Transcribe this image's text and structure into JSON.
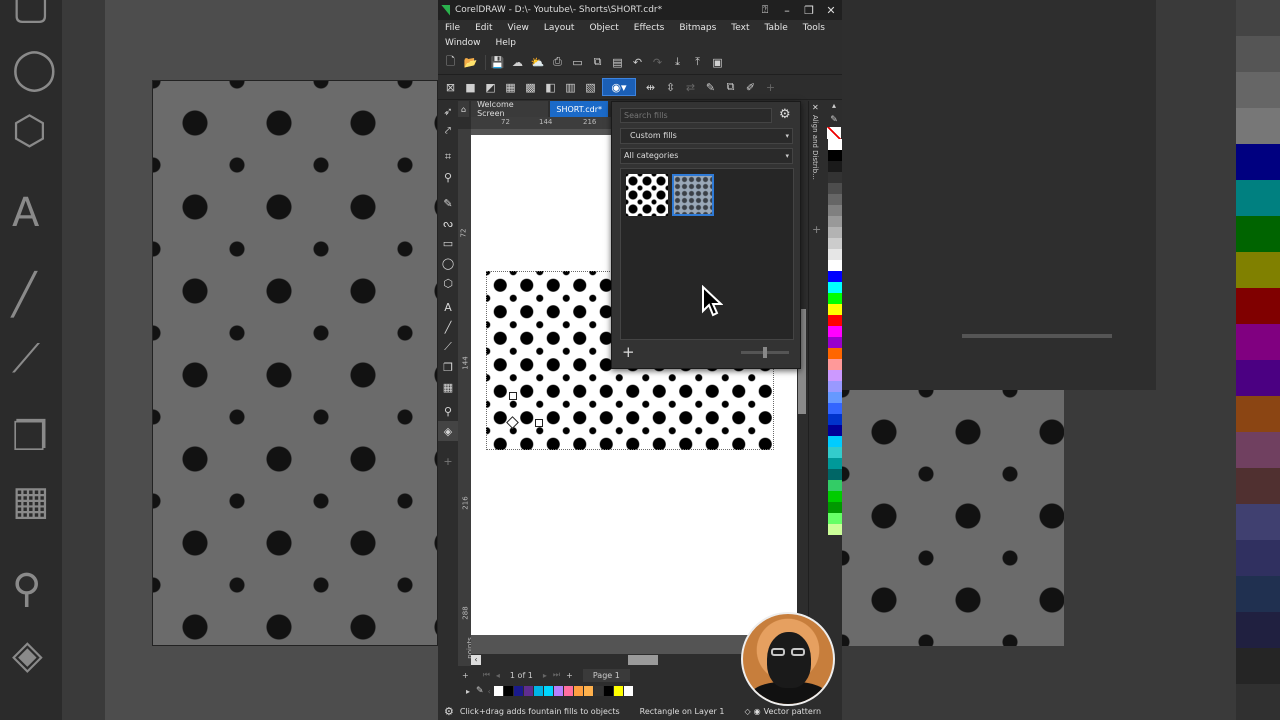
{
  "window": {
    "title": "CorelDRAW - D:\\- Youtube\\- Shorts\\SHORT.cdr*",
    "minimize": "–",
    "restore": "❐",
    "close": "✕"
  },
  "menu": {
    "row1": [
      "File",
      "Edit",
      "View",
      "Layout",
      "Object",
      "Effects",
      "Bitmaps",
      "Text",
      "Table",
      "Tools"
    ],
    "row2": [
      "Window",
      "Help"
    ]
  },
  "tabs": {
    "home_icon": "home-icon",
    "welcome": "Welcome Screen",
    "document": "SHORT.cdr*"
  },
  "rulers": {
    "h_ticks": [
      "72",
      "144",
      "216"
    ],
    "v_ticks": [
      "72",
      "144",
      "216",
      "288"
    ],
    "v_unit": "points"
  },
  "fill_picker": {
    "search_placeholder": "Search fills",
    "source": "Custom fills",
    "category": "All categories"
  },
  "pagebar": {
    "page_count": "1 of 1",
    "page_tab": "Page 1"
  },
  "status": {
    "hint": "Click+drag adds fountain fills to objects",
    "selection": "Rectangle on Layer 1",
    "fill_type": "Vector pattern"
  },
  "colors": {
    "accent": "#1b6ac8",
    "palette_strip": [
      "#ffffff",
      "#000000",
      "#1a1a8c",
      "#5f2d8f",
      "#00b4e6",
      "#00d6ff",
      "#b580ff",
      "#ff6fa0",
      "#ff9f40",
      "#ffb14d",
      "#333333",
      "#000000",
      "#ffff00",
      "#ffffff"
    ],
    "vertical_palette": [
      "#ffffff",
      "#000000",
      "#1a1a1a",
      "#333333",
      "#4d4d4d",
      "#666666",
      "#808080",
      "#999999",
      "#b3b3b3",
      "#cccccc",
      "#e6e6e6",
      "#ffffff",
      "#0000ff",
      "#00ffff",
      "#00ff00",
      "#ffff00",
      "#ff0000",
      "#ff00ff",
      "#9900cc",
      "#ff6600",
      "#ff9999",
      "#cc99ff",
      "#9999ff",
      "#6699ff",
      "#3366ff",
      "#0033cc",
      "#000099",
      "#00ccff",
      "#33cccc",
      "#009999",
      "#006666",
      "#33cc66",
      "#00cc00",
      "#009900",
      "#66ff66",
      "#ccff99"
    ]
  }
}
